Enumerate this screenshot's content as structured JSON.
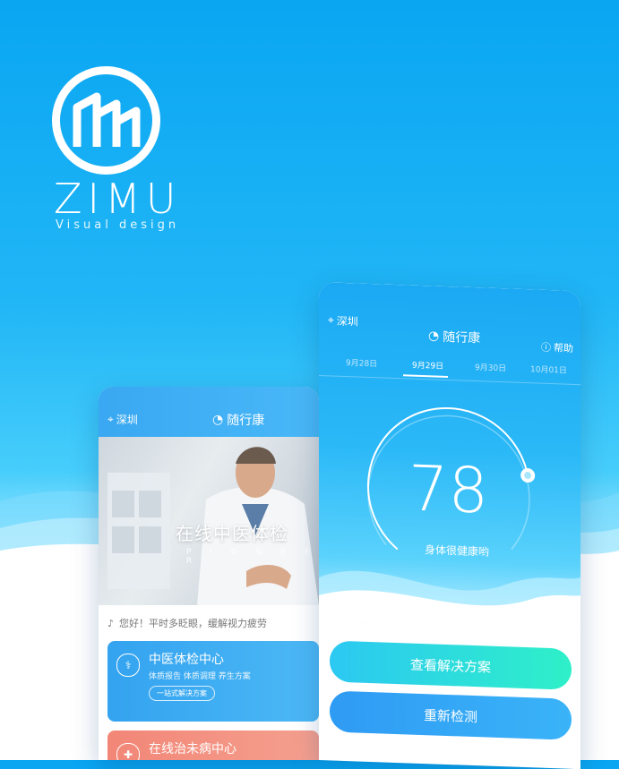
{
  "brand": {
    "name": "ZIMU",
    "tagline": "Visual design"
  },
  "left_screen": {
    "location": "深圳",
    "app_title": "随行康",
    "hero": {
      "title": "在线中医体检",
      "subtitle": "P I O N E E R"
    },
    "notice": "您好！平时多眨眼，缓解视力疲劳",
    "cards": [
      {
        "title": "中医体检中心",
        "subtitle": "体质报告  体质调理  养生方案",
        "pill": "一站式解决方案"
      },
      {
        "title": "在线治未病中心"
      }
    ]
  },
  "right_screen": {
    "location": "深圳",
    "app_title": "随行康",
    "help_label": "帮助",
    "dates": [
      "9月28日",
      "9月29日",
      "9月30日",
      "10月01日"
    ],
    "active_date_index": 1,
    "score": "78",
    "gauge_fraction": 0.78,
    "status_text": "身体很健康哟",
    "buttons": {
      "solution": "查看解决方案",
      "retest": "重新检测"
    }
  },
  "colors": {
    "primary_blue": "#1ba9f4",
    "accent_green": "#2ef0c8",
    "card_red": "#f28677"
  }
}
